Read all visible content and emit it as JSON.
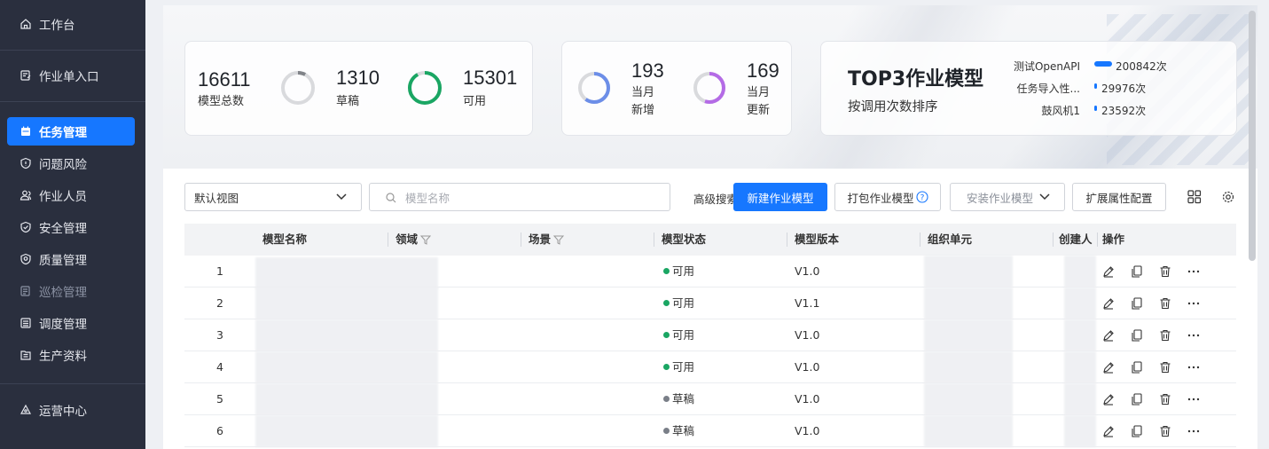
{
  "sidebar": {
    "items": [
      {
        "label": "工作台",
        "icon": "home-icon"
      },
      {
        "label": "作业单入口",
        "icon": "form-icon"
      },
      {
        "label": "任务管理",
        "icon": "calendar-icon",
        "active": true
      },
      {
        "label": "问题风险",
        "icon": "shield-icon"
      },
      {
        "label": "作业人员",
        "icon": "people-icon"
      },
      {
        "label": "安全管理",
        "icon": "shield-check-icon"
      },
      {
        "label": "质量管理",
        "icon": "shield-quality-icon"
      },
      {
        "label": "巡检管理",
        "icon": "inspect-icon",
        "dim": true
      },
      {
        "label": "调度管理",
        "icon": "list-icon"
      },
      {
        "label": "生产资料",
        "icon": "book-icon"
      },
      {
        "label": "运营中心",
        "icon": "operations-icon"
      }
    ]
  },
  "stats": {
    "total": {
      "value": "16611",
      "label": "模型总数"
    },
    "draft": {
      "value": "1310",
      "label": "草稿",
      "ratio": 0.079
    },
    "available": {
      "value": "15301",
      "label": "可用",
      "ratio": 0.921
    },
    "new_month": {
      "value": "193",
      "label1": "当月",
      "label2": "新增",
      "ratio": 0.6
    },
    "updated_month": {
      "value": "169",
      "label1": "当月",
      "label2": "更新",
      "ratio": 0.55
    }
  },
  "top3": {
    "title": "TOP3作业模型",
    "subtitle": "按调用次数排序",
    "items": [
      {
        "name": "测试OpenAPI",
        "value": "200842次",
        "ratio": 1.0
      },
      {
        "name": "任务导入性...",
        "value": "29976次",
        "ratio": 0.15
      },
      {
        "name": "鼓风机1",
        "value": "23592次",
        "ratio": 0.12
      }
    ]
  },
  "toolbar": {
    "view_select": "默认视图",
    "search_placeholder": "模型名称",
    "advanced_search": "高级搜索",
    "new_model": "新建作业模型",
    "pack_model": "打包作业模型",
    "install_model": "安装作业模型",
    "extend_config": "扩展属性配置"
  },
  "table": {
    "columns": [
      "模型名称",
      "领域",
      "场景",
      "模型状态",
      "模型版本",
      "组织单元",
      "创建人",
      "操作"
    ],
    "rows": [
      {
        "index": "1",
        "status": "可用",
        "status_color": "#1aa663",
        "version": "V1.0"
      },
      {
        "index": "2",
        "status": "可用",
        "status_color": "#1aa663",
        "version": "V1.1"
      },
      {
        "index": "3",
        "status": "可用",
        "status_color": "#1aa663",
        "version": "V1.0"
      },
      {
        "index": "4",
        "status": "可用",
        "status_color": "#1aa663",
        "version": "V1.0"
      },
      {
        "index": "5",
        "status": "草稿",
        "status_color": "#7a7f88",
        "version": "V1.0"
      },
      {
        "index": "6",
        "status": "草稿",
        "status_color": "#7a7f88",
        "version": "V1.0"
      }
    ]
  },
  "colors": {
    "primary": "#1677ff",
    "available": "#1aa663",
    "draft": "#7a7f88",
    "sidebar": "#2a2f3e"
  }
}
